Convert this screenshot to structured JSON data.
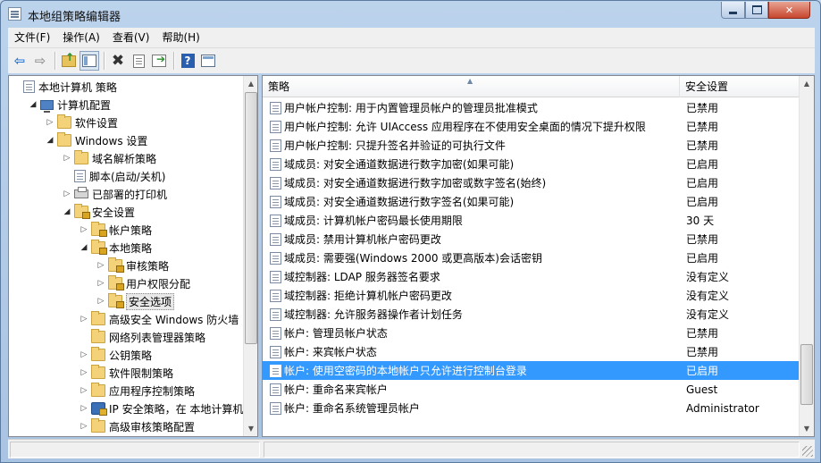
{
  "window": {
    "title": "本地组策略编辑器"
  },
  "menu": [
    "文件(F)",
    "操作(A)",
    "查看(V)",
    "帮助(H)"
  ],
  "toolbar": {
    "icons": [
      "back-arrow-icon",
      "forward-arrow-icon",
      "up-folder-icon",
      "show-tree-icon",
      "delete-icon",
      "properties-icon",
      "export-list-icon",
      "help-icon",
      "show-hide-pane-icon"
    ]
  },
  "tree": [
    {
      "label": "本地计算机 策略",
      "level": 0,
      "arrow": "",
      "icon": "policy-doc"
    },
    {
      "label": "计算机配置",
      "level": 1,
      "arrow": "expanded",
      "icon": "computer"
    },
    {
      "label": "软件设置",
      "level": 2,
      "arrow": "collapsed",
      "icon": "folder"
    },
    {
      "label": "Windows 设置",
      "level": 2,
      "arrow": "expanded",
      "icon": "folder"
    },
    {
      "label": "域名解析策略",
      "level": 3,
      "arrow": "collapsed",
      "icon": "folder"
    },
    {
      "label": "脚本(启动/关机)",
      "level": 3,
      "arrow": "",
      "icon": "policy-doc"
    },
    {
      "label": "已部署的打印机",
      "level": 3,
      "arrow": "collapsed",
      "icon": "printer"
    },
    {
      "label": "安全设置",
      "level": 3,
      "arrow": "expanded",
      "icon": "lock-folder"
    },
    {
      "label": "帐户策略",
      "level": 4,
      "arrow": "collapsed",
      "icon": "lock-folder"
    },
    {
      "label": "本地策略",
      "level": 4,
      "arrow": "expanded",
      "icon": "lock-folder"
    },
    {
      "label": "审核策略",
      "level": 5,
      "arrow": "collapsed",
      "icon": "lock-folder"
    },
    {
      "label": "用户权限分配",
      "level": 5,
      "arrow": "collapsed",
      "icon": "lock-folder"
    },
    {
      "label": "安全选项",
      "level": 5,
      "arrow": "collapsed",
      "icon": "lock-folder",
      "selected": true
    },
    {
      "label": "高级安全 Windows 防火墙",
      "level": 4,
      "arrow": "collapsed",
      "icon": "folder"
    },
    {
      "label": "网络列表管理器策略",
      "level": 4,
      "arrow": "",
      "icon": "folder"
    },
    {
      "label": "公钥策略",
      "level": 4,
      "arrow": "collapsed",
      "icon": "folder"
    },
    {
      "label": "软件限制策略",
      "level": 4,
      "arrow": "collapsed",
      "icon": "folder"
    },
    {
      "label": "应用程序控制策略",
      "level": 4,
      "arrow": "collapsed",
      "icon": "folder"
    },
    {
      "label": "IP 安全策略，在 本地计算机",
      "level": 4,
      "arrow": "collapsed",
      "icon": "ipsec"
    },
    {
      "label": "高级审核策略配置",
      "level": 4,
      "arrow": "collapsed",
      "icon": "folder"
    }
  ],
  "list": {
    "columns": [
      "策略",
      "安全设置"
    ],
    "rows": [
      {
        "name": "用户帐户控制: 用于内置管理员帐户的管理员批准模式",
        "value": "已禁用"
      },
      {
        "name": "用户帐户控制: 允许 UIAccess 应用程序在不使用安全桌面的情况下提升权限",
        "value": "已禁用"
      },
      {
        "name": "用户帐户控制: 只提升签名并验证的可执行文件",
        "value": "已禁用"
      },
      {
        "name": "域成员: 对安全通道数据进行数字加密(如果可能)",
        "value": "已启用"
      },
      {
        "name": "域成员: 对安全通道数据进行数字加密或数字签名(始终)",
        "value": "已启用"
      },
      {
        "name": "域成员: 对安全通道数据进行数字签名(如果可能)",
        "value": "已启用"
      },
      {
        "name": "域成员: 计算机帐户密码最长使用期限",
        "value": "30 天"
      },
      {
        "name": "域成员: 禁用计算机帐户密码更改",
        "value": "已禁用"
      },
      {
        "name": "域成员: 需要强(Windows 2000 或更高版本)会话密钥",
        "value": "已启用"
      },
      {
        "name": "域控制器: LDAP 服务器签名要求",
        "value": "没有定义"
      },
      {
        "name": "域控制器: 拒绝计算机帐户密码更改",
        "value": "没有定义"
      },
      {
        "name": "域控制器: 允许服务器操作者计划任务",
        "value": "没有定义"
      },
      {
        "name": "帐户: 管理员帐户状态",
        "value": "已禁用"
      },
      {
        "name": "帐户: 来宾帐户状态",
        "value": "已禁用"
      },
      {
        "name": "帐户: 使用空密码的本地帐户只允许进行控制台登录",
        "value": "已启用",
        "selected": true
      },
      {
        "name": "帐户: 重命名来宾帐户",
        "value": "Guest"
      },
      {
        "name": "帐户: 重命名系统管理员帐户",
        "value": "Administrator"
      }
    ]
  }
}
